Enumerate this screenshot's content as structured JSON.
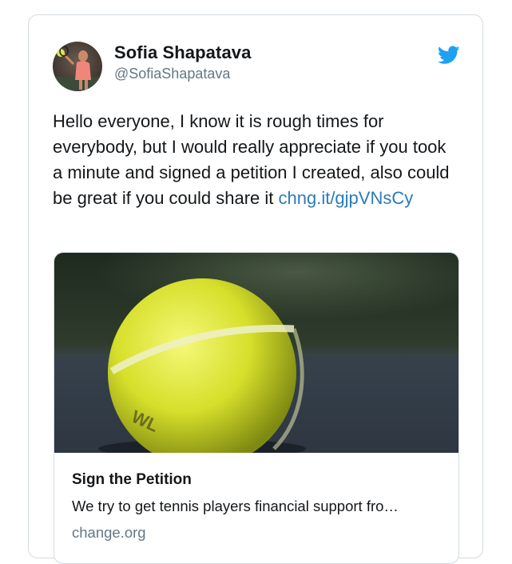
{
  "tweet": {
    "author": {
      "name": "Sofia Shapatava",
      "handle": "@SofiaShapatava",
      "avatar_icon": "tennis-player-avatar"
    },
    "brand_icon": "twitter-bird-icon",
    "brand_color": "#1da1f2",
    "text": "Hello everyone, I know it is rough times for everybody, but I would really appreciate if you took a minute and signed a petition I created, also could be great if you could share it ",
    "link": "chng.it/gjpVNsCy",
    "link_color": "#2b7bb9"
  },
  "link_card": {
    "image": "tennis-ball-photo",
    "title": "Sign the Petition",
    "description": "We try to get tennis players financial support fro…",
    "domain": "change.org"
  }
}
